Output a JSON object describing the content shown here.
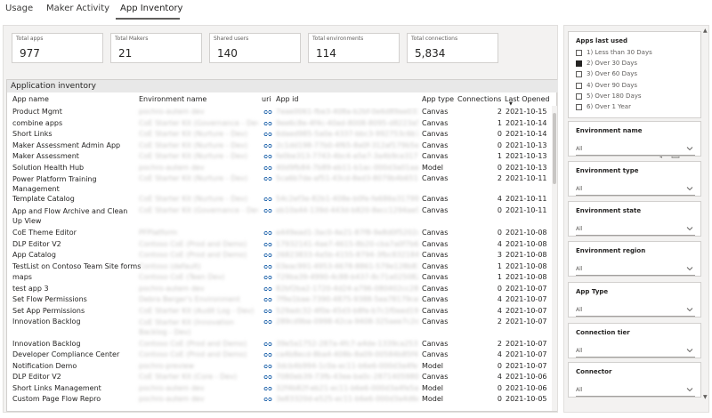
{
  "tabs": [
    "Usage",
    "Maker Activity",
    "App Inventory"
  ],
  "kpis": [
    {
      "label": "Total apps",
      "value": "977"
    },
    {
      "label": "Total Makers",
      "value": "21"
    },
    {
      "label": "Shared users",
      "value": "140"
    },
    {
      "label": "Total environments",
      "value": "114"
    },
    {
      "label": "Total connections",
      "value": "5,834"
    }
  ],
  "table": {
    "title": "Application inventory",
    "headers": [
      "App name",
      "Environment name",
      "uri",
      "App id",
      "App type",
      "Connections",
      "Last Opened"
    ],
    "rows": [
      {
        "name": "Product Mgmt",
        "env": "pochro-autem dev",
        "id": "7eae0061-fbe3-408a-b2bf-0e6d89ae033",
        "type": "Canvas",
        "conn": "2",
        "date": "2021-10-15"
      },
      {
        "name": "combine apps",
        "env": "CoE Starter Kit (Governance - Dev)",
        "id": "9ee6c8e-4f4c-40ad-8008-8095-d8223a5b64ee",
        "type": "Canvas",
        "conn": "1",
        "date": "2021-10-14"
      },
      {
        "name": "Short Links",
        "env": "CoE Starter Kit (Nurture - Dev)",
        "id": "6daed985-5a0a-4337-bbc3-992753c6b7",
        "type": "Canvas",
        "conn": "0",
        "date": "2021-10-14"
      },
      {
        "name": "Maker Assessment Admin App",
        "env": "CoE Starter Kit (Nurture - Dev)",
        "id": "2c1dd198-77b0-4f65-8a0f-312af179b5e",
        "type": "Canvas",
        "conn": "0",
        "date": "2021-10-13"
      },
      {
        "name": "Maker Assessment",
        "env": "CoE Starter Kit (Nurture - Dev)",
        "id": "fe0be313-7743-4bc4-a5e7-3a4b9ce3175e",
        "type": "Canvas",
        "conn": "1",
        "date": "2021-10-13"
      },
      {
        "name": "Solution Health Hub",
        "env": "pochro-autem dev",
        "id": "40d9fb84-7b89-eb11-b1ac-000d3a01aa35",
        "type": "Model",
        "conn": "0",
        "date": "2021-10-13"
      },
      {
        "name": "Power Platform Training Management",
        "env": "CoE Starter Kit (Nurture - Dev)",
        "id": "5ca6b7de-af51-43cd-8ed3-8079b4b651de",
        "type": "Canvas",
        "conn": "2",
        "date": "2021-10-11"
      },
      {
        "name": "Template Catalog",
        "env": "CoE Starter Kit (Nurture - Dev)",
        "id": "54c2ef3e-82b1-408e-b0fe-fe686a317991",
        "type": "Canvas",
        "conn": "4",
        "date": "2021-10-11"
      },
      {
        "name": "App and Flow Archive and Clean Up View",
        "env": "CoE Starter Kit (Governance - Dev)",
        "id": "eb10a44-139d-443d-b820-8ecc1294ae9",
        "type": "Canvas",
        "conn": "0",
        "date": "2021-10-11"
      },
      {
        "name": "CoE Theme Editor",
        "env": "PFPlatform",
        "id": "e449ead1-3ac0-4e21-87f8-9e8d0f5202a",
        "type": "Canvas",
        "conn": "0",
        "date": "2021-10-08"
      },
      {
        "name": "DLP Editor V2",
        "env": "Contoso CoE (Prod and Demo)",
        "id": "17932141-4ae7-4615-8b20-cba7a0f7b6a8",
        "type": "Canvas",
        "conn": "4",
        "date": "2021-10-08"
      },
      {
        "name": "App Catalog",
        "env": "Contoso CoE (Prod and Demo)",
        "id": "26823833-4a5b-4155-8794-3fbc8321849b",
        "type": "Canvas",
        "conn": "3",
        "date": "2021-10-08"
      },
      {
        "name": "TestList on Contoso Team Site forms",
        "env": "Contoso (default)",
        "id": "03eac991-4953-4678-8861-579e128b833",
        "type": "Canvas",
        "conn": "1",
        "date": "2021-10-08"
      },
      {
        "name": "maps",
        "env": "Contoso CoE (Teen Dev)",
        "id": "729ba39-4990-4c88-b437-8c71a0250821",
        "type": "Canvas",
        "conn": "1",
        "date": "2021-10-08"
      },
      {
        "name": "test app 3",
        "env": "pochro-autem dev",
        "id": "82bf2ba2-1720-4d24-a796-080402cc2858",
        "type": "Canvas",
        "conn": "0",
        "date": "2021-10-07"
      },
      {
        "name": "Set Flow Permissions",
        "env": "Debra Berger's Environment",
        "id": "7f9e1bae-7390-4875-9388-5ea78179ce40",
        "type": "Canvas",
        "conn": "4",
        "date": "2021-10-07"
      },
      {
        "name": "Set App Permissions",
        "env": "CoE Starter Kit (Audit Log - Dev)",
        "id": "529adc32-4f0e-45d3-b8fe-b7c1f0eed19",
        "type": "Canvas",
        "conn": "4",
        "date": "2021-10-07"
      },
      {
        "name": "Innovation Backlog",
        "env": "CoE Starter Kit (Innovation Backlog - Dev)",
        "id": "289cd9be-0998-42ca-9408-325aee7c2d1c",
        "type": "Canvas",
        "conn": "2",
        "date": "2021-10-07"
      },
      {
        "name": "Innovation Backlog",
        "env": "Contoso CoE (Prod and Demo)",
        "id": "39e5a1752-287a-4fc7-a4de-1339ca2536ca",
        "type": "Canvas",
        "conn": "2",
        "date": "2021-10-07"
      },
      {
        "name": "Developer Compliance Center",
        "env": "Contoso CoE (Prod and Demo)",
        "id": "ca4b8ecd-8ba4-408b-8a09-00584b85f44",
        "type": "Canvas",
        "conn": "4",
        "date": "2021-10-07"
      },
      {
        "name": "Notification Demo",
        "env": "pochro-preview",
        "id": "3dcb4b994-1c0a-ec11-b6e6-000d3a4fe5af",
        "type": "Model",
        "conn": "0",
        "date": "2021-10-07"
      },
      {
        "name": "DLP Editor V2",
        "env": "CoE Starter Kit (Core - Dev)",
        "id": "7080eb39-73fb-43ee-ba0c-28714059803",
        "type": "Canvas",
        "conn": "4",
        "date": "2021-10-06"
      },
      {
        "name": "Short Links Management",
        "env": "pochro-autem dev",
        "id": "32f4b82f-eb21-ec11-b6e6-000d3a4fe5af",
        "type": "Model",
        "conn": "0",
        "date": "2021-10-06"
      },
      {
        "name": "Custom Page Flow Repro",
        "env": "pochro-autem dev",
        "id": "3e83320d-e525-ec11-b6e6-000d3a4d6e5b",
        "type": "Model",
        "conn": "0",
        "date": "2021-10-05"
      }
    ]
  },
  "slicers": {
    "apps_last_used": {
      "title": "Apps last used",
      "options": [
        {
          "label": "1) Less than 30 Days",
          "checked": false
        },
        {
          "label": "2) Over 30 Days",
          "checked": true
        },
        {
          "label": "3) Over 60 Days",
          "checked": false
        },
        {
          "label": "4) Over 90 Days",
          "checked": false
        },
        {
          "label": "5) Over 180 Days",
          "checked": false
        },
        {
          "label": "6) Over 1 Year",
          "checked": false
        }
      ]
    },
    "dropdowns": [
      {
        "title": "Environment name",
        "value": "All"
      },
      {
        "title": "Environment type",
        "value": "All"
      },
      {
        "title": "Environment state",
        "value": "All"
      },
      {
        "title": "Environment region",
        "value": "All"
      },
      {
        "title": "App Type",
        "value": "All"
      },
      {
        "title": "Connection tier",
        "value": "All"
      },
      {
        "title": "Connector",
        "value": "All"
      }
    ]
  },
  "icons": {
    "uri": "link-icon",
    "filter": "filter-icon",
    "focus": "focus-mode-icon",
    "more": "more-options-icon",
    "sort": "sort-descending-icon"
  }
}
